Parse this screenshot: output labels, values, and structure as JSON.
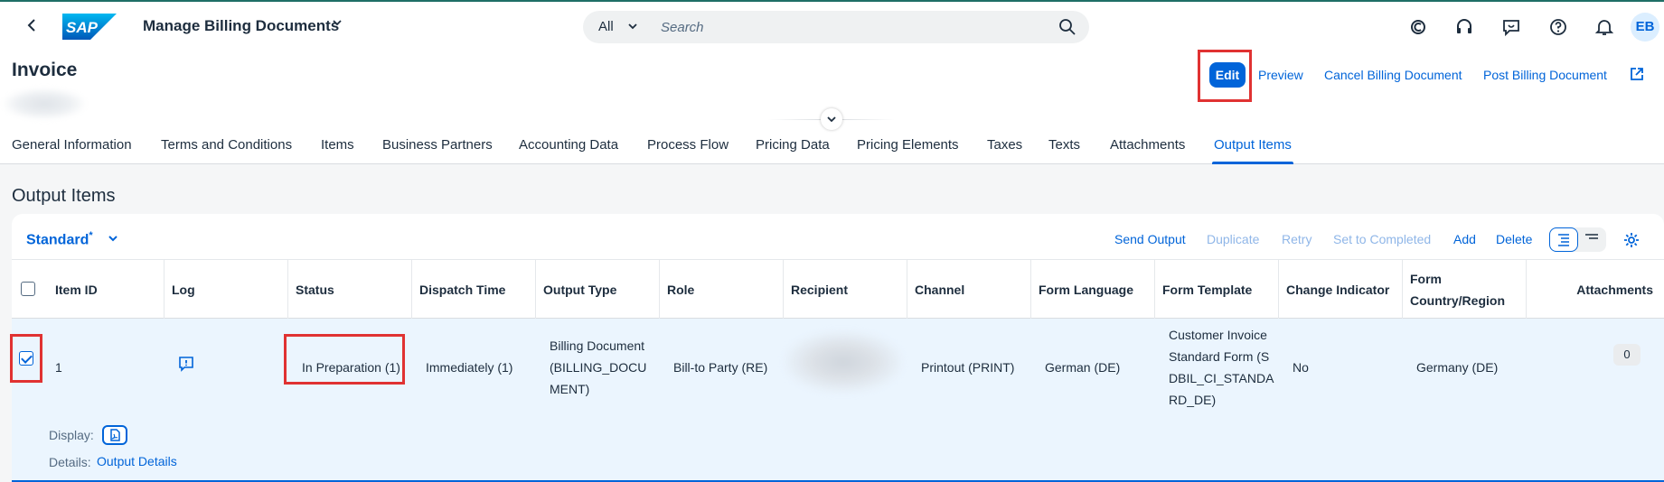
{
  "shell": {
    "app_title": "Manage Billing Documents",
    "search_scope": "All",
    "search_placeholder": "Search",
    "avatar_initials": "EB",
    "brand_color": "#0064d9"
  },
  "header": {
    "title": "Invoice",
    "actions": {
      "edit": "Edit",
      "preview": "Preview",
      "cancel": "Cancel Billing Document",
      "post": "Post Billing Document"
    }
  },
  "tabs": [
    "General Information",
    "Terms and Conditions",
    "Items",
    "Business Partners",
    "Accounting Data",
    "Process Flow",
    "Pricing Data",
    "Pricing Elements",
    "Taxes",
    "Texts",
    "Attachments",
    "Output Items"
  ],
  "active_tab": "Output Items",
  "section": {
    "title": "Output Items",
    "variant": "Standard",
    "variant_modified": "*",
    "toolbar": {
      "send_output": "Send Output",
      "duplicate": "Duplicate",
      "retry": "Retry",
      "set_completed": "Set to Completed",
      "add": "Add",
      "delete": "Delete"
    }
  },
  "table": {
    "columns": [
      "Item ID",
      "Log",
      "Status",
      "Dispatch Time",
      "Output Type",
      "Role",
      "Recipient",
      "Channel",
      "Form Language",
      "Form Template",
      "Change Indicator",
      "Form Country/Region",
      "Attachments"
    ],
    "row": {
      "selected": true,
      "item_id": "1",
      "status": "In Preparation (1)",
      "dispatch_time": "Immediately (1)",
      "output_type": "Billing Document (BILLING_DOCUMENT)",
      "role": "Bill-to Party (RE)",
      "channel": "Printout (PRINT)",
      "form_language": "German (DE)",
      "form_template": "Customer Invoice Standard Form (SDBIL_CI_STANDARD_DE)",
      "change_indicator": "No",
      "form_country": "Germany (DE)",
      "attachments": "0",
      "display_label": "Display:",
      "details_label": "Details:",
      "details_link": "Output Details"
    }
  },
  "highlight_color": "#e03232"
}
